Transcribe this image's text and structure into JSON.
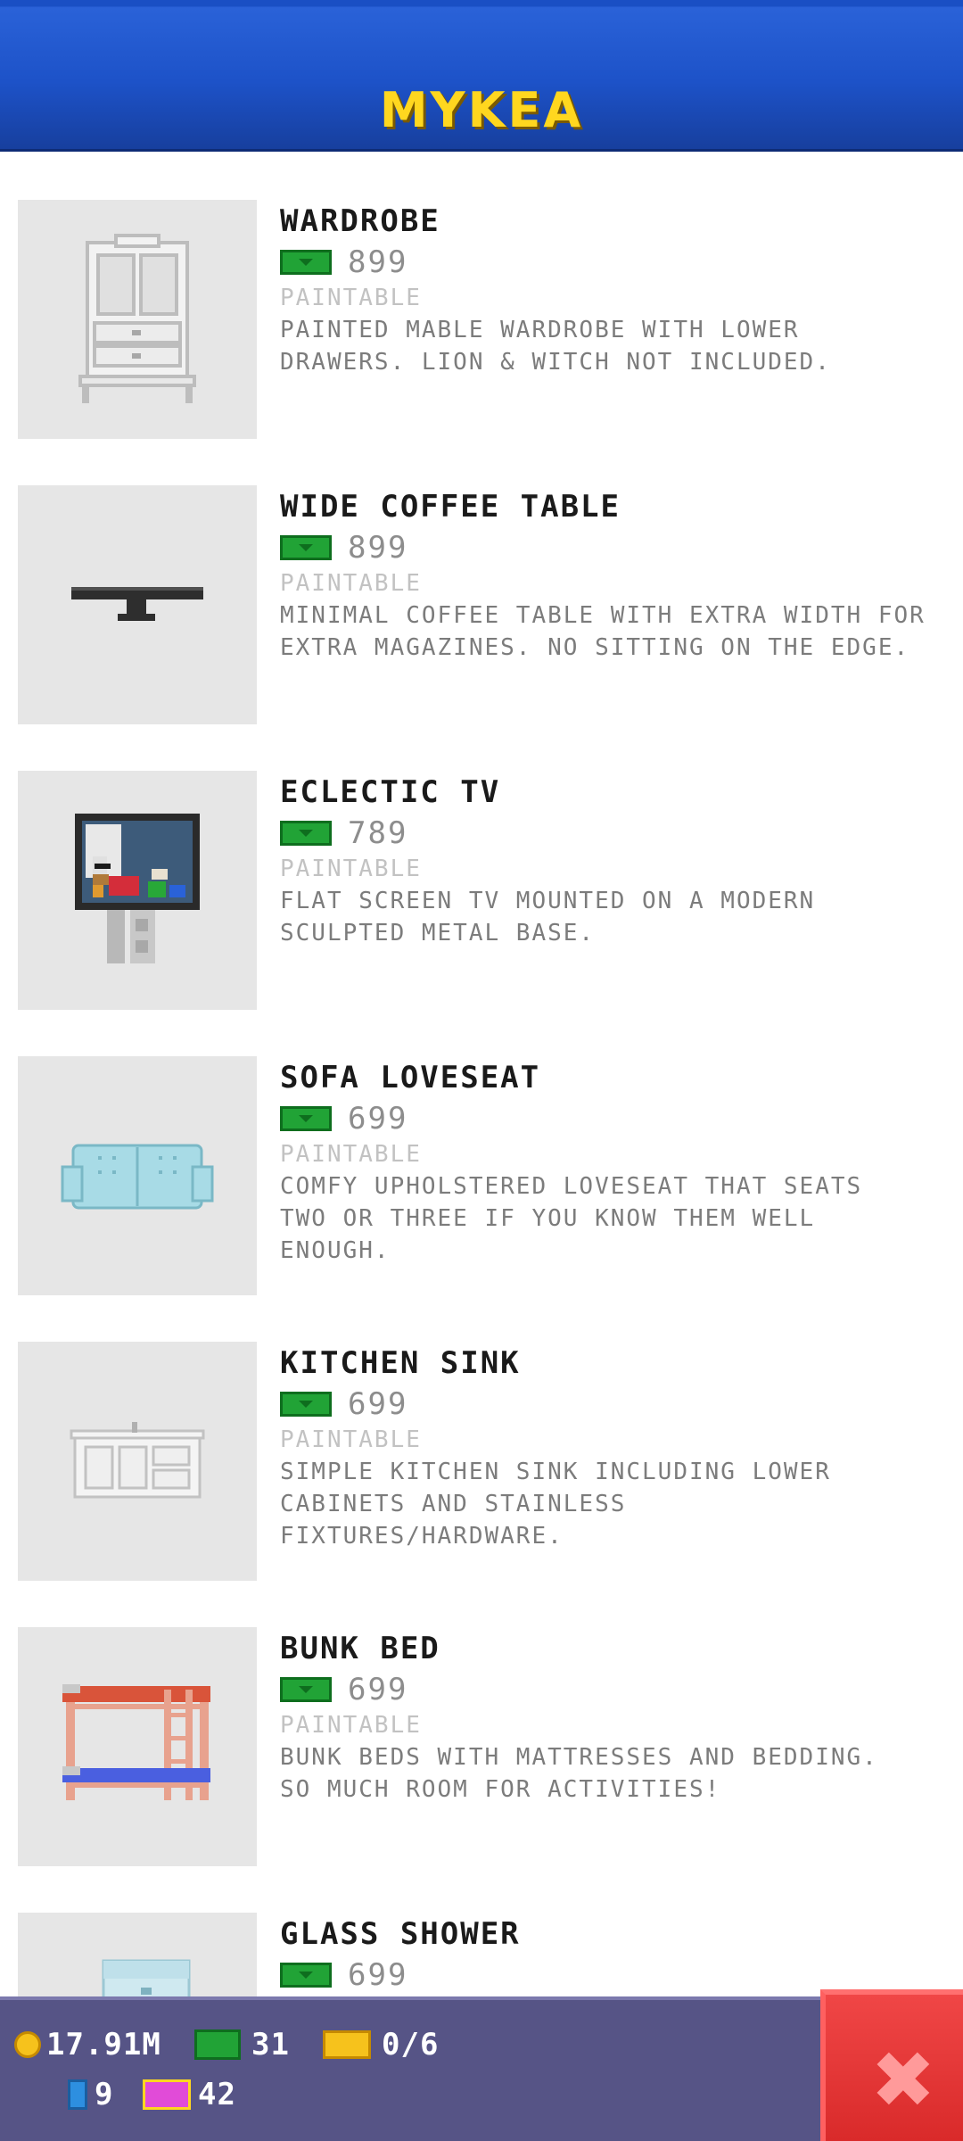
{
  "header": {
    "title": "MYKEA"
  },
  "items": [
    {
      "name": "WARDROBE",
      "price": "899",
      "tag": "PAINTABLE",
      "desc_lines": [
        "PAINTED MABLE WARDROBE WITH LOWER",
        "DRAWERS. LION & WITCH NOT INCLUDED."
      ]
    },
    {
      "name": "WIDE COFFEE TABLE",
      "price": "899",
      "tag": "PAINTABLE",
      "desc_lines": [
        "MINIMAL COFFEE TABLE WITH EXTRA WIDTH FOR",
        "EXTRA MAGAZINES. NO SITTING ON THE EDGE."
      ]
    },
    {
      "name": "ECLECTIC TV",
      "price": "789",
      "tag": "PAINTABLE",
      "desc_lines": [
        "FLAT SCREEN TV MOUNTED ON A MODERN",
        "SCULPTED METAL BASE."
      ]
    },
    {
      "name": "SOFA LOVESEAT",
      "price": "699",
      "tag": "PAINTABLE",
      "desc_lines": [
        "COMFY UPHOLSTERED LOVESEAT THAT SEATS",
        "TWO OR THREE IF YOU KNOW THEM WELL",
        "ENOUGH."
      ]
    },
    {
      "name": "KITCHEN SINK",
      "price": "699",
      "tag": "PAINTABLE",
      "desc_lines": [
        "SIMPLE KITCHEN SINK INCLUDING LOWER",
        "CABINETS AND STAINLESS",
        "FIXTURES/HARDWARE."
      ]
    },
    {
      "name": "BUNK BED",
      "price": "699",
      "tag": "PAINTABLE",
      "desc_lines": [
        "BUNK BEDS WITH MATTRESSES AND BEDDING.",
        "SO MUCH ROOM FOR ACTIVITIES!"
      ]
    },
    {
      "name": "GLASS SHOWER",
      "price": "699"
    }
  ],
  "status": {
    "coins": "17.91M",
    "bux": "31",
    "tickets": "0/6",
    "bitizens": "9",
    "premium_bux": "42"
  },
  "colors": {
    "accent_yellow": "#ffd71f",
    "header_blue": "#1d52c8",
    "bar_purple": "#565486",
    "close_red": "#e03434"
  }
}
